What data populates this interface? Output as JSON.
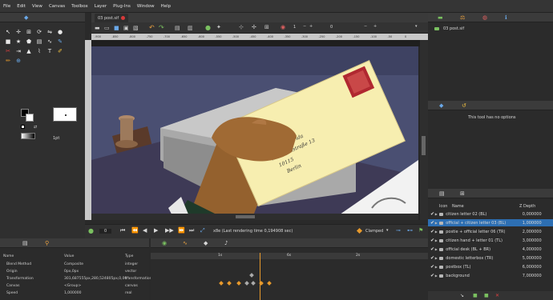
{
  "menu": [
    "File",
    "Edit",
    "View",
    "Canvas",
    "Toolbox",
    "Layer",
    "Plug-Ins",
    "Window",
    "Help"
  ],
  "document": {
    "tab_title": "03 post.sif"
  },
  "canvas_toolbar": {
    "frame_value": "1",
    "zoom_value": "0"
  },
  "ruler_ticks": [
    "-900",
    "-850",
    "-800",
    "-750",
    "-700",
    "-650",
    "-600",
    "-550",
    "-500",
    "-450",
    "-400",
    "-350",
    "-300",
    "-250",
    "-200",
    "-150",
    "-100",
    "-50",
    "0"
  ],
  "toolbox": {
    "width_label": "1pt"
  },
  "timebar": {
    "current_time": "0",
    "render_status": "x8e (Last rendering time 0,194908 sec)",
    "interpolation": "Clamped"
  },
  "canvas_browser": {
    "file": "03 post.sif"
  },
  "tool_options": {
    "message": "This tool has no options"
  },
  "layers_panel": {
    "columns": {
      "icon": "Icon",
      "name": "Name",
      "zdepth": "Z Depth"
    },
    "rows": [
      {
        "name": "citizen letter 02 (BL)",
        "z": "0,000000",
        "selected": false
      },
      {
        "name": "official + citizen letter 03 (BL)",
        "z": "1,000000",
        "selected": true
      },
      {
        "name": "postie + official letter 06 (TR)",
        "z": "2,000000",
        "selected": false
      },
      {
        "name": "citizen hand + letter 01 (TL)",
        "z": "3,000000",
        "selected": false
      },
      {
        "name": "official desk (BL + BR)",
        "z": "4,000000",
        "selected": false
      },
      {
        "name": "domestic letterbox (TR)",
        "z": "5,000000",
        "selected": false
      },
      {
        "name": "postbox (TL)",
        "z": "6,000000",
        "selected": false
      },
      {
        "name": "background",
        "z": "7,000000",
        "selected": false
      }
    ]
  },
  "params_panel": {
    "columns": {
      "name": "Name",
      "value": "Value",
      "type": "Type"
    },
    "rows": [
      {
        "name": "Blend Method",
        "value": "Composite",
        "type": "integer"
      },
      {
        "name": "Origin",
        "value": "0px,0px",
        "type": "vector"
      },
      {
        "name": "Transformation",
        "value": "301,687555px,280,524805px,0,00°",
        "type": "transformation"
      },
      {
        "name": "Canvas",
        "value": "<Group>",
        "type": "canvas"
      },
      {
        "name": "Speed",
        "value": "1,000000",
        "type": "real"
      }
    ]
  },
  "timetrack": {
    "labels": [
      "1s",
      "6s",
      "2s"
    ]
  },
  "colors": {
    "accent": "#2d6fb3",
    "keyframe": "#e89a2c",
    "canvas_wall": "#4a4f72"
  },
  "envelope_text": [
    "Musikschule Frida",
    "Wellentinstraße 13",
    "10115",
    "Berlin"
  ]
}
